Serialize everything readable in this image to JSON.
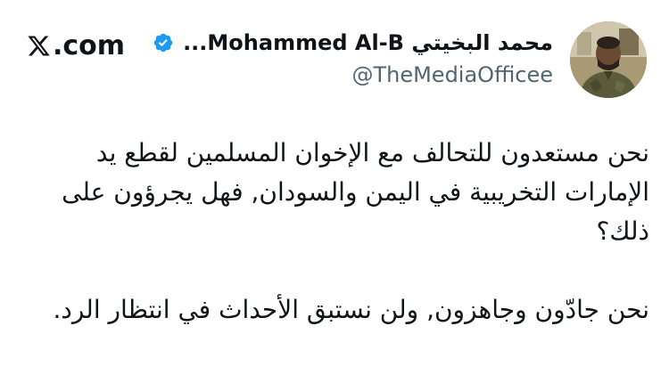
{
  "brand": {
    "icon": "x-logo-icon",
    "text": ".com"
  },
  "user": {
    "display_name": "محمد البخيتي Mohammed Al-B...",
    "handle": "@TheMediaOfficee",
    "verified_icon": "verified-badge-icon",
    "verified_color": "#1d9bf0",
    "avatar_icon": "profile-photo"
  },
  "tweet": {
    "paragraph_1": "نحن مستعدون للتحالف مع الإخوان المسلمين لقطع يد الإمارات التخريبية في اليمن والسودان, فهل يجرؤون على ذلك؟",
    "paragraph_2": "نحن جادّون وجاهزون, ولن نستبق الأحداث في انتظار الرد."
  },
  "colors": {
    "text": "#0f1419",
    "secondary": "#536471",
    "accent": "#1d9bf0"
  }
}
